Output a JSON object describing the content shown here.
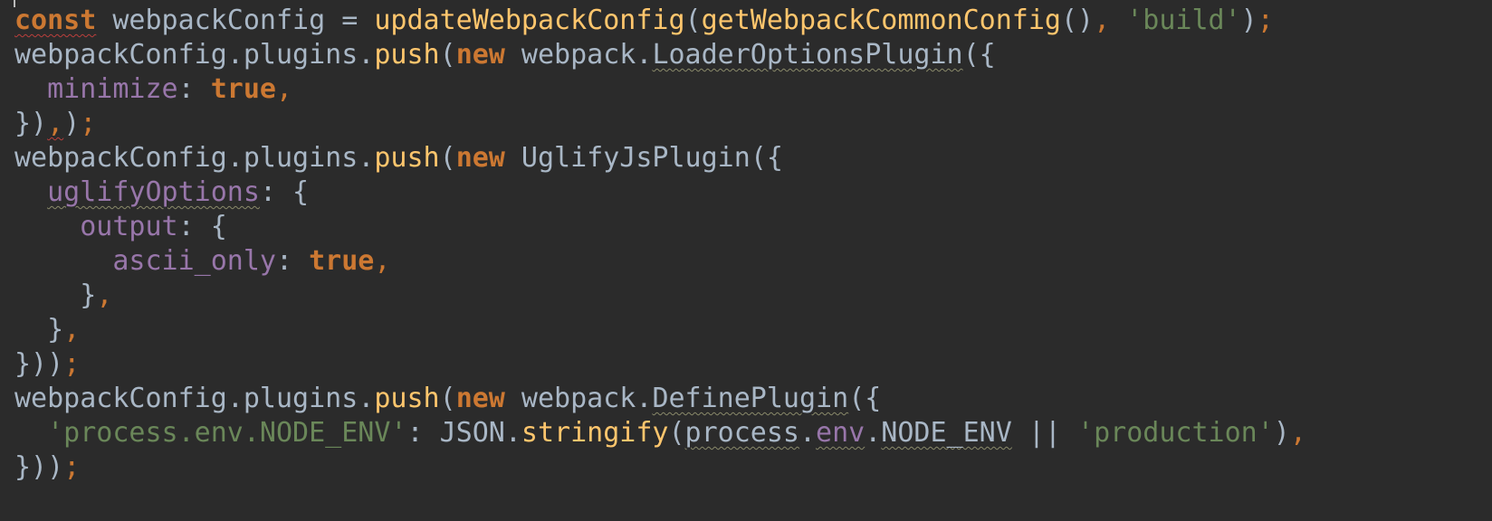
{
  "lines": [
    [
      {
        "t": "const",
        "c": "keyword",
        "err": true
      },
      {
        "t": " ",
        "c": "space"
      },
      {
        "t": "webpackConfig",
        "c": "ident"
      },
      {
        "t": " = ",
        "c": "op"
      },
      {
        "t": "updateWebpackConfig",
        "c": "func"
      },
      {
        "t": "(",
        "c": "punct"
      },
      {
        "t": "getWebpackCommonConfig",
        "c": "func"
      },
      {
        "t": "()",
        "c": "punct"
      },
      {
        "t": ", ",
        "c": "comma"
      },
      {
        "t": "'build'",
        "c": "string"
      },
      {
        "t": ")",
        "c": "punct"
      },
      {
        "t": ";",
        "c": "comma"
      }
    ],
    [
      {
        "t": "webpackConfig",
        "c": "ident"
      },
      {
        "t": ".",
        "c": "punct"
      },
      {
        "t": "plugins",
        "c": "ident"
      },
      {
        "t": ".",
        "c": "punct"
      },
      {
        "t": "push",
        "c": "func"
      },
      {
        "t": "(",
        "c": "punct"
      },
      {
        "t": "new",
        "c": "keyword"
      },
      {
        "t": " webpack.",
        "c": "ident"
      },
      {
        "t": "LoaderOptionsPlugin",
        "c": "ident",
        "sq": true
      },
      {
        "t": "({",
        "c": "punct"
      }
    ],
    [
      {
        "t": "  ",
        "c": "space"
      },
      {
        "t": "minimize",
        "c": "prop"
      },
      {
        "t": ": ",
        "c": "punct"
      },
      {
        "t": "true",
        "c": "keyword"
      },
      {
        "t": ",",
        "c": "comma"
      }
    ],
    [
      {
        "t": "})",
        "c": "punct"
      },
      {
        "t": ",",
        "c": "comma",
        "err": true
      },
      {
        "t": ")",
        "c": "punct"
      },
      {
        "t": ";",
        "c": "comma"
      }
    ],
    [
      {
        "t": "webpackConfig",
        "c": "ident"
      },
      {
        "t": ".",
        "c": "punct"
      },
      {
        "t": "plugins",
        "c": "ident"
      },
      {
        "t": ".",
        "c": "punct"
      },
      {
        "t": "push",
        "c": "func"
      },
      {
        "t": "(",
        "c": "punct"
      },
      {
        "t": "new",
        "c": "keyword"
      },
      {
        "t": " UglifyJsPlugin",
        "c": "ident"
      },
      {
        "t": "({",
        "c": "punct"
      }
    ],
    [
      {
        "t": "  ",
        "c": "space"
      },
      {
        "t": "uglifyOptions",
        "c": "prop",
        "sq": true
      },
      {
        "t": ": {",
        "c": "punct"
      }
    ],
    [
      {
        "t": "    ",
        "c": "space"
      },
      {
        "t": "output",
        "c": "prop"
      },
      {
        "t": ": {",
        "c": "punct"
      }
    ],
    [
      {
        "t": "      ",
        "c": "space"
      },
      {
        "t": "ascii_only",
        "c": "prop"
      },
      {
        "t": ": ",
        "c": "punct"
      },
      {
        "t": "true",
        "c": "keyword"
      },
      {
        "t": ",",
        "c": "comma"
      }
    ],
    [
      {
        "t": "    ",
        "c": "space"
      },
      {
        "t": "}",
        "c": "punct"
      },
      {
        "t": ",",
        "c": "comma"
      }
    ],
    [
      {
        "t": "  ",
        "c": "space"
      },
      {
        "t": "}",
        "c": "punct"
      },
      {
        "t": ",",
        "c": "comma"
      }
    ],
    [
      {
        "t": "}))",
        "c": "punct"
      },
      {
        "t": ";",
        "c": "comma"
      }
    ],
    [
      {
        "t": "webpackConfig",
        "c": "ident"
      },
      {
        "t": ".",
        "c": "punct"
      },
      {
        "t": "plugins",
        "c": "ident"
      },
      {
        "t": ".",
        "c": "punct"
      },
      {
        "t": "push",
        "c": "func"
      },
      {
        "t": "(",
        "c": "punct"
      },
      {
        "t": "new",
        "c": "keyword"
      },
      {
        "t": " webpack.",
        "c": "ident"
      },
      {
        "t": "DefinePlugin",
        "c": "ident",
        "sq": true
      },
      {
        "t": "({",
        "c": "punct"
      }
    ],
    [
      {
        "t": "  ",
        "c": "space"
      },
      {
        "t": "'process.env.NODE_ENV'",
        "c": "string"
      },
      {
        "t": ": JSON.",
        "c": "ident"
      },
      {
        "t": "stringify",
        "c": "func"
      },
      {
        "t": "(",
        "c": "punct"
      },
      {
        "t": "process",
        "c": "ident",
        "sq": true
      },
      {
        "t": ".",
        "c": "punct"
      },
      {
        "t": "env",
        "c": "prop",
        "sq": true
      },
      {
        "t": ".",
        "c": "punct"
      },
      {
        "t": "NODE_ENV",
        "c": "ident",
        "sq": true
      },
      {
        "t": " || ",
        "c": "op"
      },
      {
        "t": "'production'",
        "c": "string"
      },
      {
        "t": ")",
        "c": "punct"
      },
      {
        "t": ",",
        "c": "comma"
      }
    ],
    [
      {
        "t": "}))",
        "c": "punct"
      },
      {
        "t": ";",
        "c": "comma"
      }
    ]
  ]
}
